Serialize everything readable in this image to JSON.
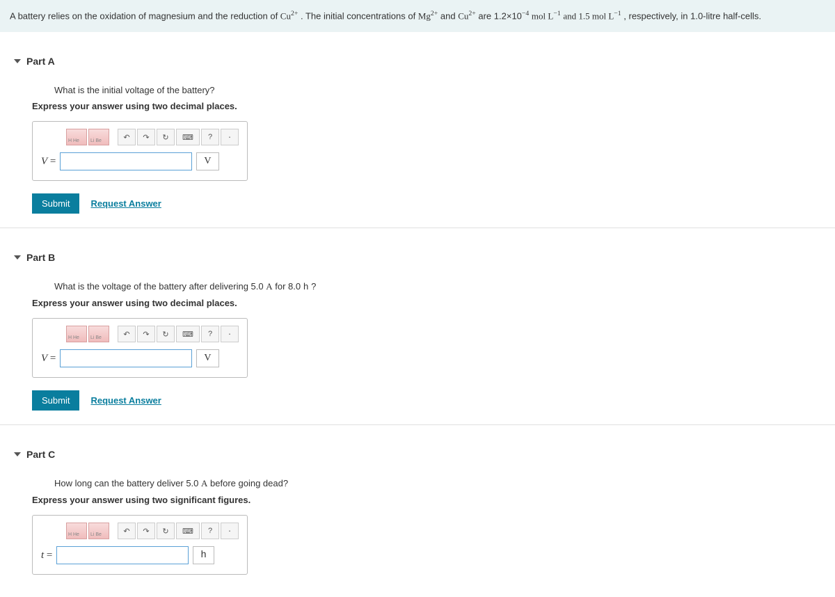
{
  "problem": {
    "prefix": "A battery relies on the oxidation of magnesium and the reduction of ",
    "cu2": "Cu",
    "sup2p": "2+",
    "mid1": " . The initial concentrations of ",
    "mg2": "Mg",
    "mid2": "  and ",
    "mid3": "  are 1.2×10",
    "exp4": "−4",
    "mid4": "  mol L",
    "expn1": "−1",
    "mid5": "  and 1.5  mol L",
    "mid6": "  , respectively, in 1.0-litre half-cells."
  },
  "toolbar": {
    "periodic1": "H  He",
    "periodic2": "Li  Be",
    "undo": "↶",
    "redo": "↷",
    "reset": "↻",
    "keyboard": "⌨",
    "help": "?",
    "more": "⋅"
  },
  "common": {
    "submit": "Submit",
    "request": "Request Answer"
  },
  "partA": {
    "title": "Part A",
    "question": "What is the initial voltage of the battery?",
    "instruction": "Express your answer using two decimal places.",
    "var": "V",
    "eq": " = ",
    "unit": "V"
  },
  "partB": {
    "title": "Part B",
    "question_pre": "What is the voltage of the battery after delivering 5.0 ",
    "A": "A",
    "question_mid": "  for 8.0 ",
    "h": "h",
    "question_post": " ?",
    "instruction": "Express your answer using two decimal places.",
    "var": "V",
    "eq": " = ",
    "unit": "V"
  },
  "partC": {
    "title": "Part C",
    "question_pre": "How long can the battery deliver 5.0 ",
    "A": "A",
    "question_post": "  before going dead?",
    "instruction": "Express your answer using two significant figures.",
    "var": "t",
    "eq": " = ",
    "unit": "h"
  }
}
